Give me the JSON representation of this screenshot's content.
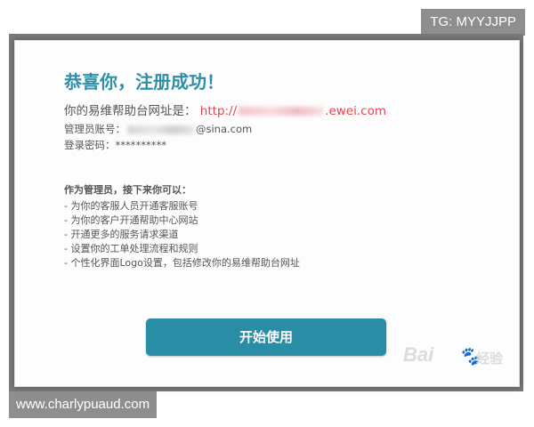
{
  "overlay": {
    "tag": "TG: MYYJJPP",
    "site": "www.charlypuaud.com"
  },
  "dialog": {
    "title": "恭喜你，注册成功！",
    "url_label": "你的易维帮助台网址是：",
    "url_prefix": "http://",
    "url_suffix": ".ewei.com",
    "account_label": "管理员账号：",
    "account_suffix": "@sina.com",
    "password_label": "登录密码：",
    "password_value": "**********",
    "admin_heading": "作为管理员，接下来你可以：",
    "admin_items": [
      "- 为你的客服人员开通客服账号",
      "- 为你的客户开通帮助中心网站",
      "- 开通更多的服务请求渠道",
      "- 设置你的工单处理流程和规则",
      "- 个性化界面Logo设置，包括修改你的易维帮助台网址"
    ],
    "start_button": "开始使用"
  },
  "watermark": {
    "brand": "Bai",
    "paw": "🐾",
    "sub": "经验"
  },
  "colors": {
    "title": "#2e8fa6",
    "url": "#e2454f",
    "button": "#2a8da6"
  }
}
